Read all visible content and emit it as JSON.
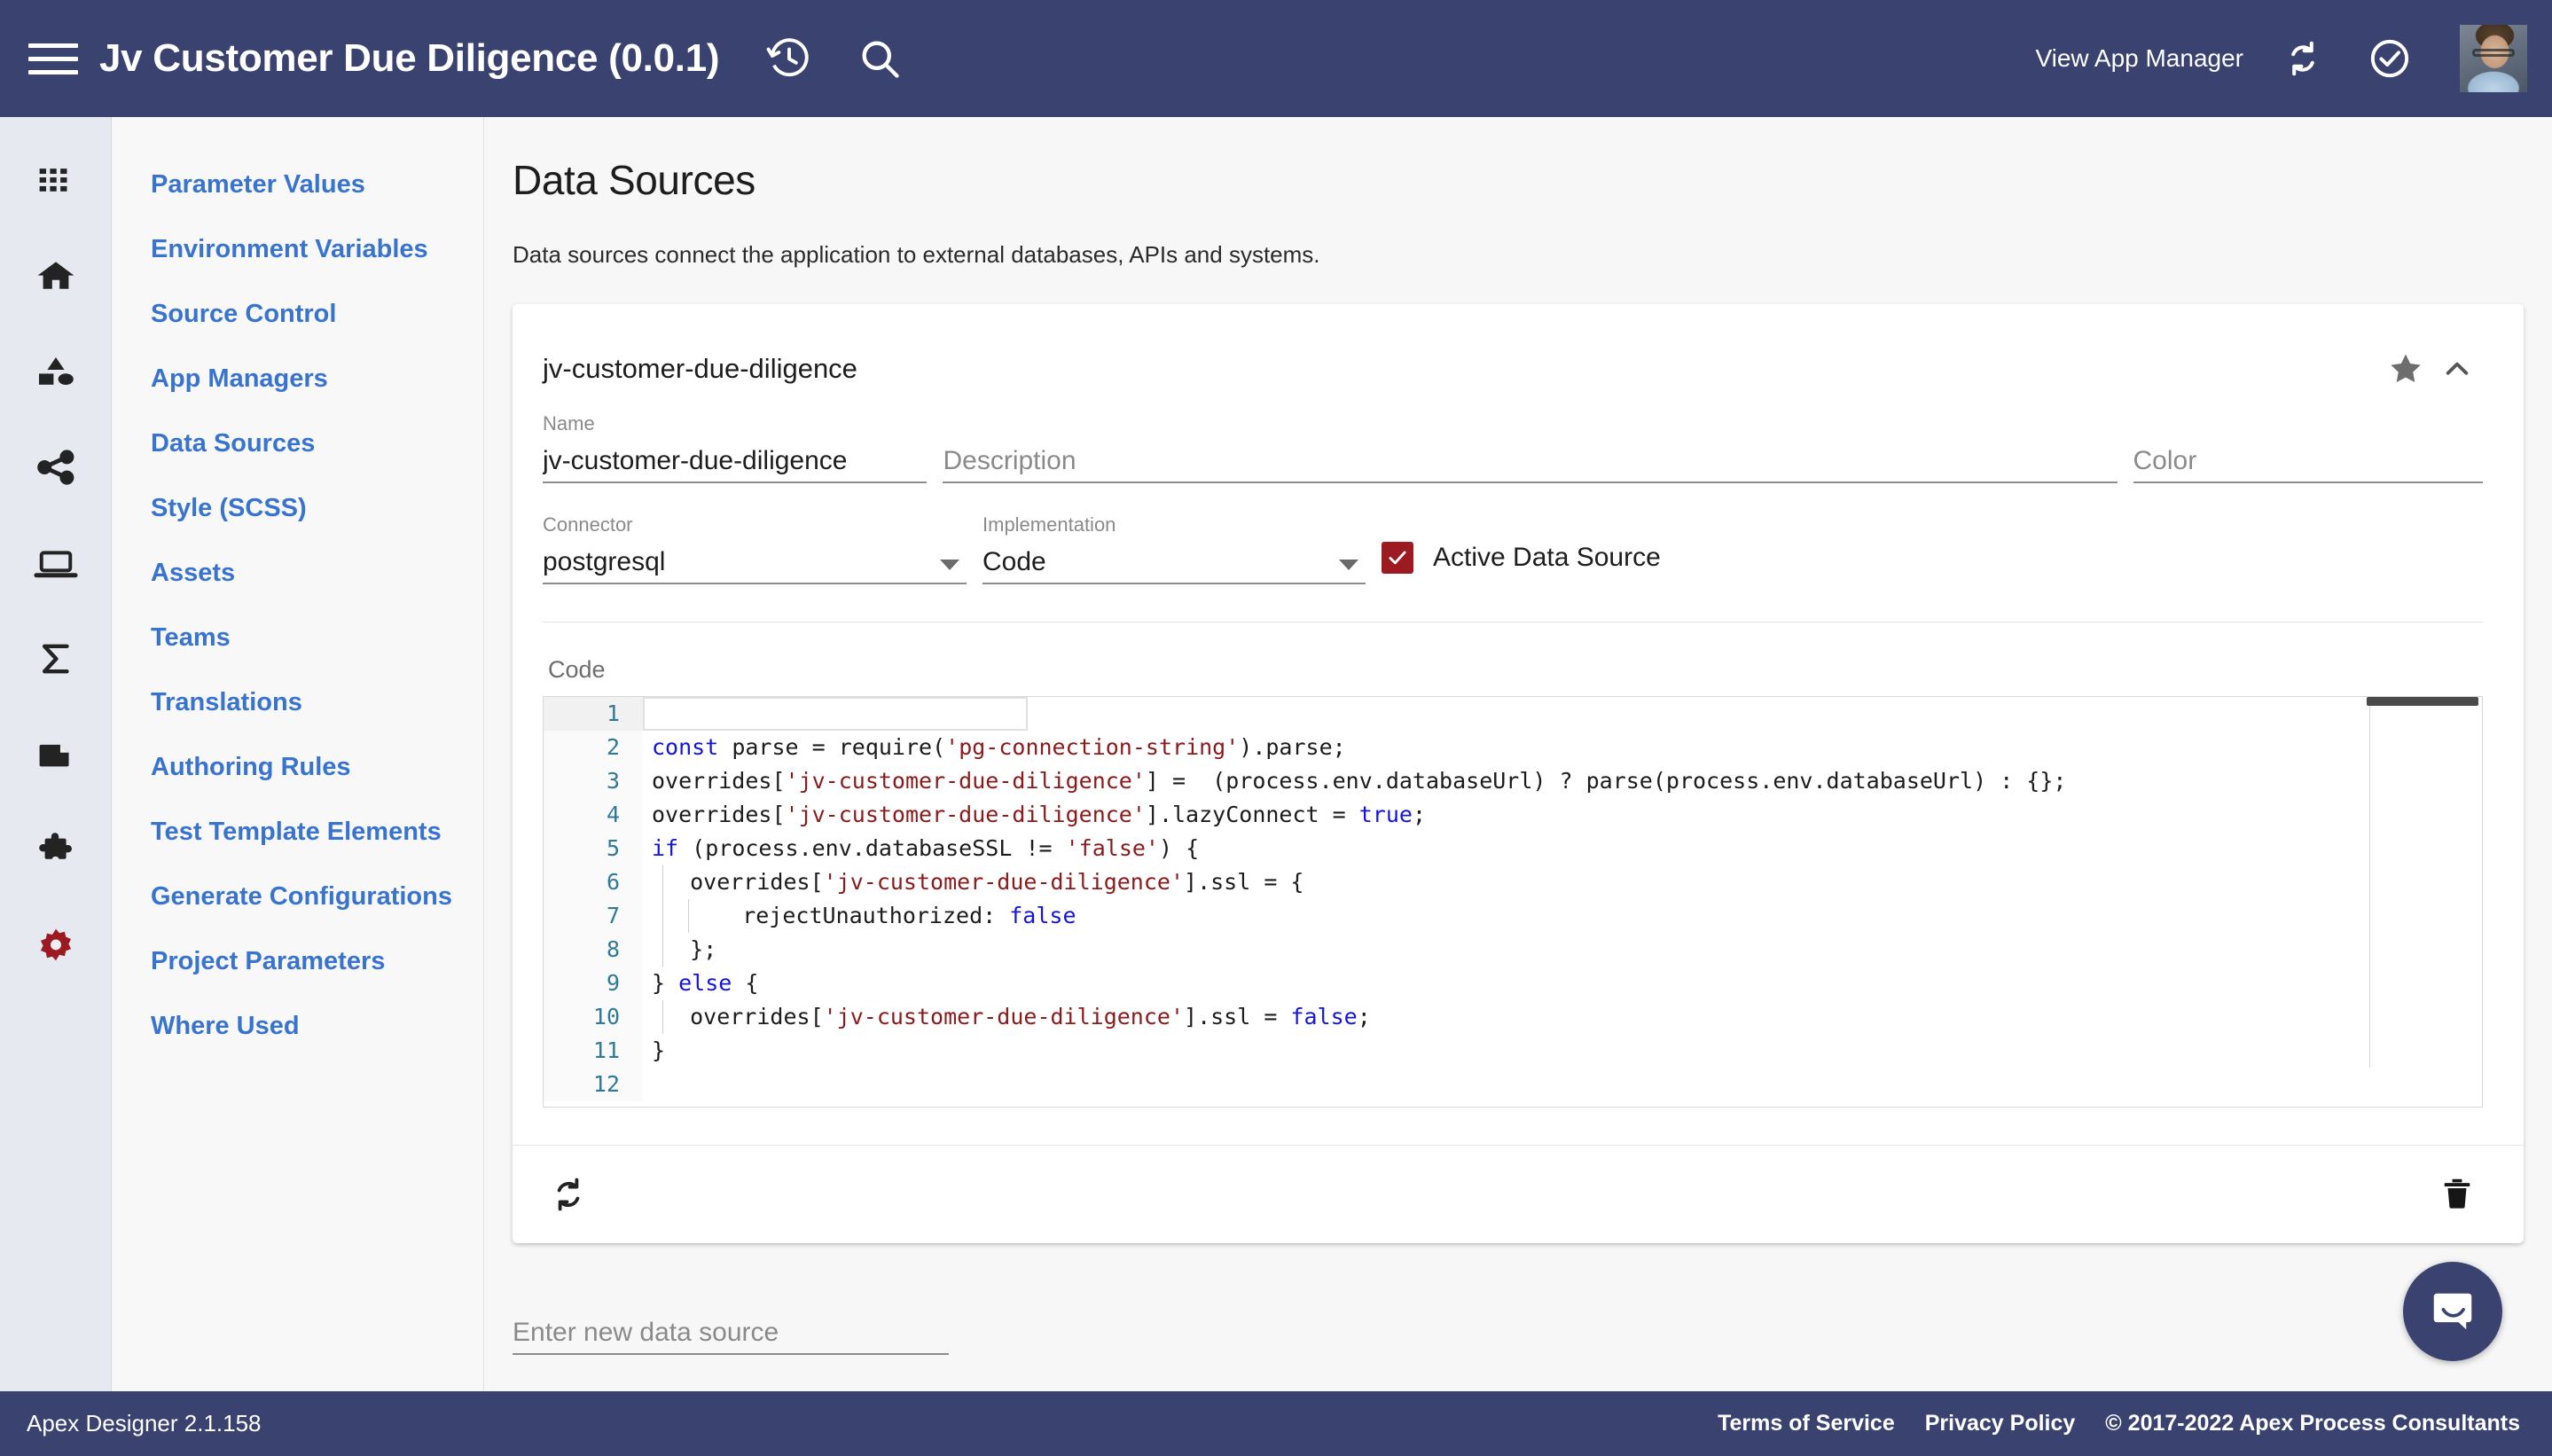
{
  "appbar": {
    "menu_icon": "hamburger-menu-icon",
    "title": "Jv Customer Due Diligence (0.0.1)",
    "history_icon": "history-clock-icon",
    "search_icon": "search-icon",
    "view_app_manager": "View App Manager",
    "sync_icon": "sync-refresh-icon",
    "check_icon": "check-circle-icon",
    "avatar": "user-avatar",
    "background": "#3a4270"
  },
  "rail": {
    "items": [
      {
        "icon": "apps-grid-icon"
      },
      {
        "icon": "home-icon"
      },
      {
        "icon": "shapes-category-icon"
      },
      {
        "icon": "share-network-icon"
      },
      {
        "icon": "laptop-icon"
      },
      {
        "icon": "sigma-sum-icon"
      },
      {
        "icon": "document-page-icon"
      },
      {
        "icon": "puzzle-piece-icon"
      },
      {
        "icon": "settings-gear-icon",
        "color": "#9b1b20"
      }
    ]
  },
  "sidebar": {
    "items": [
      {
        "label": "Parameter Values"
      },
      {
        "label": "Environment Variables"
      },
      {
        "label": "Source Control"
      },
      {
        "label": "App Managers"
      },
      {
        "label": "Data Sources"
      },
      {
        "label": "Style (SCSS)"
      },
      {
        "label": "Assets"
      },
      {
        "label": "Teams"
      },
      {
        "label": "Translations"
      },
      {
        "label": "Authoring Rules"
      },
      {
        "label": "Test Template Elements"
      },
      {
        "label": "Generate Configurations"
      },
      {
        "label": "Project Parameters"
      },
      {
        "label": "Where Used"
      }
    ],
    "link_color": "#3874cf"
  },
  "main": {
    "title": "Data Sources",
    "subtitle": "Data sources connect the application to external databases, APIs and systems."
  },
  "card": {
    "title": "jv-customer-due-diligence",
    "star_icon": "star-filled-icon",
    "collapse_icon": "chevron-up-icon",
    "fields": {
      "name": {
        "label": "Name",
        "value": "jv-customer-due-diligence"
      },
      "description": {
        "label": "",
        "placeholder": "Description",
        "value": ""
      },
      "color": {
        "label": "",
        "placeholder": "Color",
        "value": ""
      },
      "connector": {
        "label": "Connector",
        "value": "postgresql",
        "caret": "dropdown-caret-icon"
      },
      "implementation": {
        "label": "Implementation",
        "value": "Code",
        "caret": "dropdown-caret-icon"
      }
    },
    "active_checkbox": {
      "label": "Active Data Source",
      "checked": true,
      "color": "#9b1b20"
    },
    "code_label": "Code",
    "footer": {
      "refresh_icon": "sync-refresh-icon",
      "delete_icon": "trash-delete-icon"
    }
  },
  "editor": {
    "lines": [
      {
        "n": "1",
        "indent": 0,
        "active": true,
        "tokens": []
      },
      {
        "n": "2",
        "indent": 0,
        "active": false,
        "tokens": [
          {
            "t": "const",
            "c": "kw"
          },
          {
            "t": " parse = require(",
            "c": ""
          },
          {
            "t": "'pg-connection-string'",
            "c": "str"
          },
          {
            "t": ").parse;",
            "c": ""
          }
        ]
      },
      {
        "n": "3",
        "indent": 0,
        "active": false,
        "tokens": [
          {
            "t": "overrides[",
            "c": ""
          },
          {
            "t": "'jv-customer-due-diligence'",
            "c": "str"
          },
          {
            "t": "] =  (process.env.databaseUrl) ? parse(process.env.databaseUrl) : {};",
            "c": ""
          }
        ]
      },
      {
        "n": "4",
        "indent": 0,
        "active": false,
        "tokens": [
          {
            "t": "overrides[",
            "c": ""
          },
          {
            "t": "'jv-customer-due-diligence'",
            "c": "str"
          },
          {
            "t": "].lazyConnect = ",
            "c": ""
          },
          {
            "t": "true",
            "c": "kw"
          },
          {
            "t": ";",
            "c": ""
          }
        ]
      },
      {
        "n": "5",
        "indent": 0,
        "active": false,
        "tokens": [
          {
            "t": "if",
            "c": "kw"
          },
          {
            "t": " (process.env.databaseSSL != ",
            "c": ""
          },
          {
            "t": "'false'",
            "c": "str"
          },
          {
            "t": ") {",
            "c": ""
          }
        ]
      },
      {
        "n": "6",
        "indent": 1,
        "active": false,
        "tokens": [
          {
            "t": "  overrides[",
            "c": ""
          },
          {
            "t": "'jv-customer-due-diligence'",
            "c": "str"
          },
          {
            "t": "].ssl = {",
            "c": ""
          }
        ]
      },
      {
        "n": "7",
        "indent": 2,
        "active": false,
        "tokens": [
          {
            "t": "    rejectUnauthorized: ",
            "c": ""
          },
          {
            "t": "false",
            "c": "kw"
          }
        ]
      },
      {
        "n": "8",
        "indent": 1,
        "active": false,
        "tokens": [
          {
            "t": "  };",
            "c": ""
          }
        ]
      },
      {
        "n": "9",
        "indent": 0,
        "active": false,
        "tokens": [
          {
            "t": "} ",
            "c": ""
          },
          {
            "t": "else",
            "c": "kw"
          },
          {
            "t": " {",
            "c": ""
          }
        ]
      },
      {
        "n": "10",
        "indent": 1,
        "active": false,
        "tokens": [
          {
            "t": "  overrides[",
            "c": ""
          },
          {
            "t": "'jv-customer-due-diligence'",
            "c": "str"
          },
          {
            "t": "].ssl = ",
            "c": ""
          },
          {
            "t": "false",
            "c": "kw"
          },
          {
            "t": ";",
            "c": ""
          }
        ]
      },
      {
        "n": "11",
        "indent": 0,
        "active": false,
        "tokens": [
          {
            "t": "}",
            "c": ""
          }
        ]
      },
      {
        "n": "12",
        "indent": 0,
        "active": false,
        "tokens": []
      }
    ],
    "keyword_color": "#1414e0",
    "string_color": "#8b1a1a",
    "linenumber_color": "#2f7a9b"
  },
  "new_data_source": {
    "placeholder": "Enter new data source",
    "value": ""
  },
  "footer": {
    "version": "Apex Designer 2.1.158",
    "links": [
      {
        "label": "Terms of Service"
      },
      {
        "label": "Privacy Policy"
      }
    ],
    "copyright": "© 2017-2022 Apex Process Consultants",
    "background": "#3a4270"
  },
  "intercom": {
    "icon": "chat-bubble-icon",
    "color": "#3a4270"
  }
}
